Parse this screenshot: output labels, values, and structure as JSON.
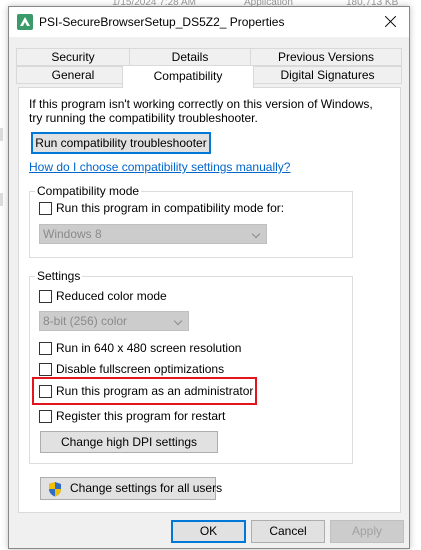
{
  "background": {
    "date_text": "1/15/2024 7:28 AM",
    "type_text": "Application",
    "size_text": "180,713 KB"
  },
  "window": {
    "title": "PSI-SecureBrowserSetup_DS5Z2_ Properties"
  },
  "tabs": {
    "row1": [
      {
        "label": "Security"
      },
      {
        "label": "Details"
      },
      {
        "label": "Previous Versions"
      }
    ],
    "row2": [
      {
        "label": "General"
      },
      {
        "label": "Compatibility",
        "active": true
      },
      {
        "label": "Digital Signatures"
      }
    ]
  },
  "compat": {
    "intro_line1": "If this program isn't working correctly on this version of Windows,",
    "intro_line2": "try running the compatibility troubleshooter.",
    "troubleshooter_button": "Run compatibility troubleshooter",
    "manual_link": "How do I choose compatibility settings manually?",
    "mode_group": {
      "legend": "Compatibility mode",
      "checkbox_label": "Run this program in compatibility mode for:",
      "checked": false,
      "os_select_value": "Windows 8"
    },
    "settings_group": {
      "legend": "Settings",
      "reduced_color": {
        "label": "Reduced color mode",
        "checked": false
      },
      "color_select_value": "8-bit (256) color",
      "res_640": {
        "label": "Run in 640 x 480 screen resolution",
        "checked": false
      },
      "disable_fullscreen": {
        "label": "Disable fullscreen optimizations",
        "checked": false
      },
      "run_as_admin": {
        "label": "Run this program as an administrator",
        "checked": false
      },
      "register_restart": {
        "label": "Register this program for restart",
        "checked": false
      },
      "dpi_button": "Change high DPI settings"
    },
    "all_users_button": "Change settings for all users"
  },
  "footer": {
    "ok": "OK",
    "cancel": "Cancel",
    "apply": "Apply"
  },
  "colors": {
    "highlight": "#e3141d",
    "link": "#0066cc",
    "accent": "#0078d7"
  }
}
